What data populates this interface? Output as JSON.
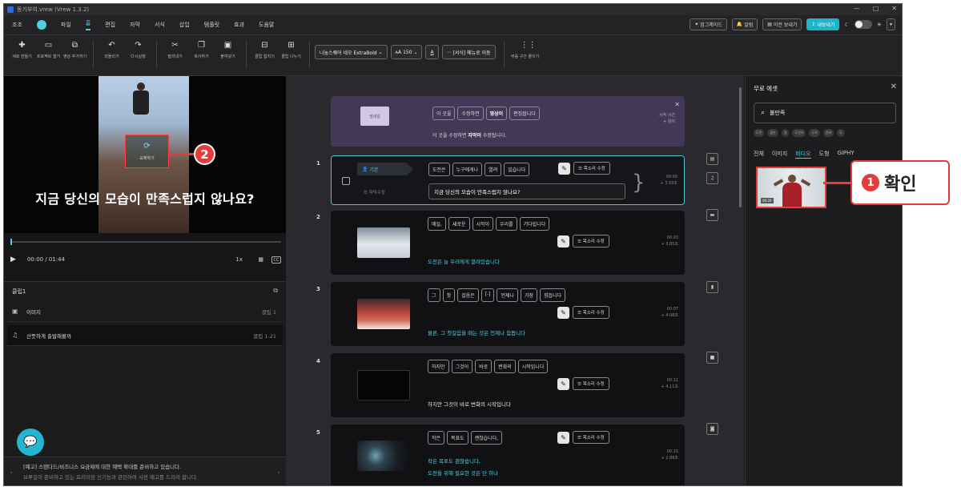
{
  "window": {
    "title": "동기부여.vrew (Vrew 1.3.2)",
    "controls": [
      "—",
      "□",
      "✕"
    ]
  },
  "menubar": {
    "items": [
      "조조",
      "파일",
      "홈",
      "편집",
      "자막",
      "서식",
      "삽입",
      "템플릿",
      "효과",
      "도움말"
    ],
    "active_index": 2,
    "right_buttons": {
      "upgrade": "업그레이드",
      "alarm": "알림",
      "prev_view": "이전 보내기",
      "export": "내보내기"
    }
  },
  "toolbar": {
    "new_project": "새로 만들기",
    "open_project": "프로젝트 열기",
    "add_video": "영상 추가하기",
    "undo": "되돌리기",
    "redo": "다시실행",
    "cut": "잘라내기",
    "copy": "복사하기",
    "paste": "붙여넣기",
    "merge_clip": "클립 합치기",
    "split_clip": "클립 나누기",
    "font": "나눔스퀘어 네오 ExtraBold",
    "font_size": "150",
    "move_text": "[서식] 메뉴로 이동",
    "silence": "무음 구간 줄이기"
  },
  "preview": {
    "subtitle": "지금 당신의 모습이 만족스럽지 않나요?",
    "replace_label": "교체하기",
    "time": "00:00 / 01:44",
    "speed": "1x",
    "badge": "2"
  },
  "cliplist": {
    "title": "클립1",
    "rows": [
      {
        "icon": "image-icon",
        "label": "이미지",
        "range": "클립 1"
      },
      {
        "icon": "music-icon",
        "label": "산뜻하게 출발해볼까",
        "range": "클립 1-21"
      }
    ],
    "notice_line1": "[예고] 스탠다드/비즈니스 요금제에 대한 혜택 확대를 준비하고 있습니다.",
    "notice_line2": "브루일이 준비하고 있는 프리미엄 신기능과 관련하여 사전 예고를 드리려 합니다.",
    "dots": "• • • • •"
  },
  "banner": {
    "thumb": "썸네일",
    "chips": [
      "이 곳을",
      "수정하면",
      "영상이",
      "편집됩니다"
    ],
    "msg_prefix": "이 곳을 수정하면",
    "msg_bold": "자막이",
    "msg_suffix": "수정됩니다.",
    "time_label": "시작 시간",
    "time_value": "+ 길이"
  },
  "scenes": [
    {
      "num": "1",
      "speaker": "기본",
      "ts_label": "자막수정",
      "chips": [
        "도전은",
        "누구에게나",
        "열려",
        "있습니다"
      ],
      "caption": "지금 당신의 모습이 만족스럽지 않나요?",
      "time1": "00:00",
      "time2": "+ 3.50초"
    },
    {
      "num": "2",
      "chips": [
        "매일,",
        "새로운",
        "시작이",
        "우리를",
        "기다립니다"
      ],
      "caption": "도전은 늘 우리에게 열려있습니다",
      "time1": "00:03",
      "time2": "+ 3.85초"
    },
    {
      "num": "3",
      "chips": [
        "그",
        "첫",
        "걸음은",
        "[-]",
        "언제나",
        "가장",
        "힘듭니다"
      ],
      "caption": "물론, 그 첫걸음을 때는 것은 언제나 힘듭니다",
      "time1": "00:07",
      "time2": "+ 4.08초"
    },
    {
      "num": "4",
      "chips": [
        "하지만",
        "그것이",
        "바로",
        "변화의",
        "시작입니다"
      ],
      "caption": "하지만 그것이 바로 변화의 시작입니다",
      "time1": "00:11",
      "time2": "+ 4.11초"
    },
    {
      "num": "5",
      "chips": [
        "작은",
        "목표도",
        "괜찮습니다,"
      ],
      "caption": "작은 목표도 괜찮습니다,",
      "caption2": "도전을 위해 필요한 것은 단 하나",
      "time1": "00:15",
      "time2": "+ 2.88초"
    }
  ],
  "voice_edit": "목소리 수정",
  "assets": {
    "title": "무료 에셋",
    "search_value": "불만족",
    "tags": [
      "도전",
      "불만",
      "걸",
      "도전하",
      "도약",
      "준비",
      "도"
    ],
    "tabs": [
      "전체",
      "이미지",
      "비디오",
      "도형",
      "GIPHY"
    ],
    "active_tab": 2,
    "thumb_duration": "00:20"
  },
  "callout": {
    "num": "1",
    "text": "확인"
  },
  "colors": {
    "accent": "#4fd0e0",
    "annotation": "#e63b3b"
  }
}
